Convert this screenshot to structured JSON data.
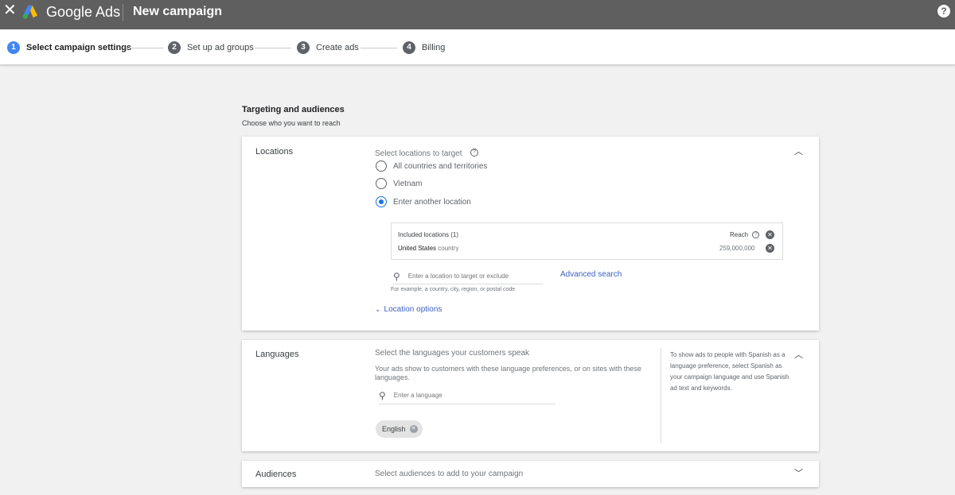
{
  "topbar": {
    "close_icon": "close-icon",
    "brand": "Google Ads",
    "title": "New campaign",
    "help_icon": "help-icon"
  },
  "stepper": {
    "steps": [
      {
        "num": "1",
        "label": "Select campaign settings",
        "active": true
      },
      {
        "num": "2",
        "label": "Set up ad groups",
        "active": false
      },
      {
        "num": "3",
        "label": "Create ads",
        "active": false
      },
      {
        "num": "4",
        "label": "Billing",
        "active": false
      }
    ]
  },
  "targeting": {
    "title": "Targeting and audiences",
    "subtitle": "Choose who you want to reach"
  },
  "locations": {
    "label": "Locations",
    "prompt": "Select locations to target",
    "options": [
      "All countries and territories",
      "Vietnam",
      "Enter another location"
    ],
    "selected": "Enter another location",
    "included_header": "Included locations (1)",
    "reach_label": "Reach",
    "included": [
      {
        "name": "United States",
        "type": "country",
        "reach": "259,000,000"
      }
    ],
    "search_placeholder": "Enter a location to target or exclude",
    "search_hint": "For example, a country, city, region, or postal code",
    "advanced_search": "Advanced search",
    "location_options": "Location options"
  },
  "languages": {
    "label": "Languages",
    "prompt": "Select the languages your customers speak",
    "description": "Your ads show to customers with these language preferences, or on sites with these languages.",
    "search_placeholder": "Enter a language",
    "chips": [
      "English"
    ],
    "side_note": "To show ads to people with Spanish as a language preference, select Spanish as your campaign language and use Spanish ad text and keywords."
  },
  "audiences": {
    "label": "Audiences",
    "prompt": "Select audiences to add to your campaign"
  },
  "colors": {
    "topbar_bg": "#5f5f5f",
    "accent": "#1a73e8",
    "link": "#3d5fc2",
    "page_bg": "#f1f1f1"
  }
}
